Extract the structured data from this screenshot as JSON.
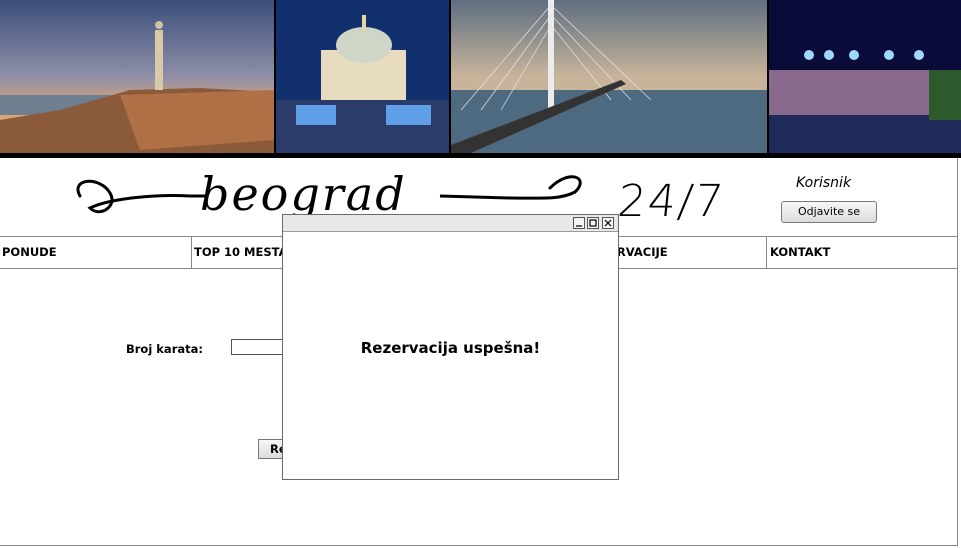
{
  "header": {
    "logo_text": "beograd",
    "logo_suffix": "24/7",
    "user_name": "Korisnik",
    "logout_label": "Odjavite se"
  },
  "nav": {
    "items": [
      {
        "label": "PONUDE"
      },
      {
        "label": "TOP 10 MESTA"
      },
      {
        "label": ""
      },
      {
        "label": "REZERVACIJE"
      },
      {
        "label": "KONTAKT"
      }
    ]
  },
  "form": {
    "ticket_label": "Broj karata:",
    "ticket_value": "",
    "submit_label": "Re"
  },
  "dialog": {
    "message": "Rezervacija uspešna!"
  },
  "colors": {
    "banner_border": "#000000",
    "nav_border": "#888888",
    "titlebar": "#e8e8e8"
  }
}
